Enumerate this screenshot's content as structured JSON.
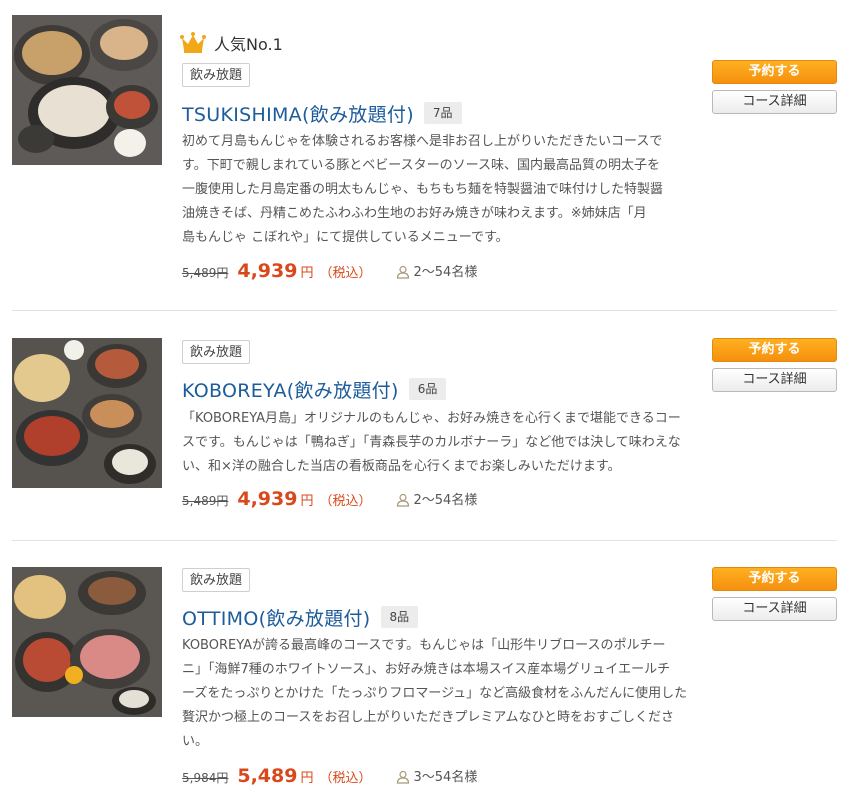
{
  "courses": [
    {
      "rank_label": "人気No.1",
      "tag": "飲み放題",
      "name": "TSUKISHIMA(飲み放題付)",
      "item_count": "7品",
      "desc_lines": [
        "初めて月島もんじゃを体験されるお客様へ是非お召し上がりいただきたいコースで",
        "す。下町で親しまれている豚とベビースターのソース味、国内最高品質の明太子を",
        "一腹使用した月島定番の明太もんじゃ、もちもち麺を特製醤油で味付けした特製醤",
        "油焼きそば、丹精こめたふわふわ生地のお好み焼きが味わえます。※姉妹店「月",
        "島もんじゃ こぼれや」にて提供しているメニューです。"
      ],
      "old_price": "5,489円",
      "price": "4,939",
      "yen": "円",
      "tax": "（税込）",
      "people": "2〜54名様",
      "reserve_label": "予約する",
      "detail_label": "コース詳細"
    },
    {
      "tag": "飲み放題",
      "name": "KOBOREYA(飲み放題付)",
      "item_count": "6品",
      "desc_lines": [
        "「KOBOREYA月島」オリジナルのもんじゃ、お好み焼きを心行くまで堪能できるコー",
        "スです。もんじゃは「鴨ねぎ」「青森長芋のカルボナーラ」など他では決して味わえな",
        "い、和×洋の融合した当店の看板商品を心行くまでお楽しみいただけます。"
      ],
      "old_price": "5,489円",
      "price": "4,939",
      "yen": "円",
      "tax": "（税込）",
      "people": "2〜54名様",
      "reserve_label": "予約する",
      "detail_label": "コース詳細"
    },
    {
      "tag": "飲み放題",
      "name": "OTTIMO(飲み放題付)",
      "item_count": "8品",
      "desc_lines": [
        "KOBOREYAが誇る最高峰のコースです。もんじゃは「山形牛リブロースのポルチー",
        "ニ」「海鮮7種のホワイトソース」、お好み焼きは本場スイス産本場グリュイエールチ",
        "ーズをたっぷりとかけた「たっぷりフロマージュ」など高級食材をふんだんに使用した",
        "贅沢かつ極上のコースをお召し上がりいただきプレミアムなひと時をおすごしくださ",
        "い。"
      ],
      "old_price": "5,984円",
      "price": "5,489",
      "yen": "円",
      "tax": "（税込）",
      "people": "3〜54名様",
      "reserve_label": "予約する",
      "detail_label": "コース詳細"
    }
  ],
  "colors": {
    "accent_orange": "#f5900f",
    "price_red": "#d9481a",
    "title_blue": "#1c5c9b",
    "crown_gold": "#f0a818"
  },
  "icons": {
    "rank": "crown-icon",
    "people": "person-icon"
  }
}
